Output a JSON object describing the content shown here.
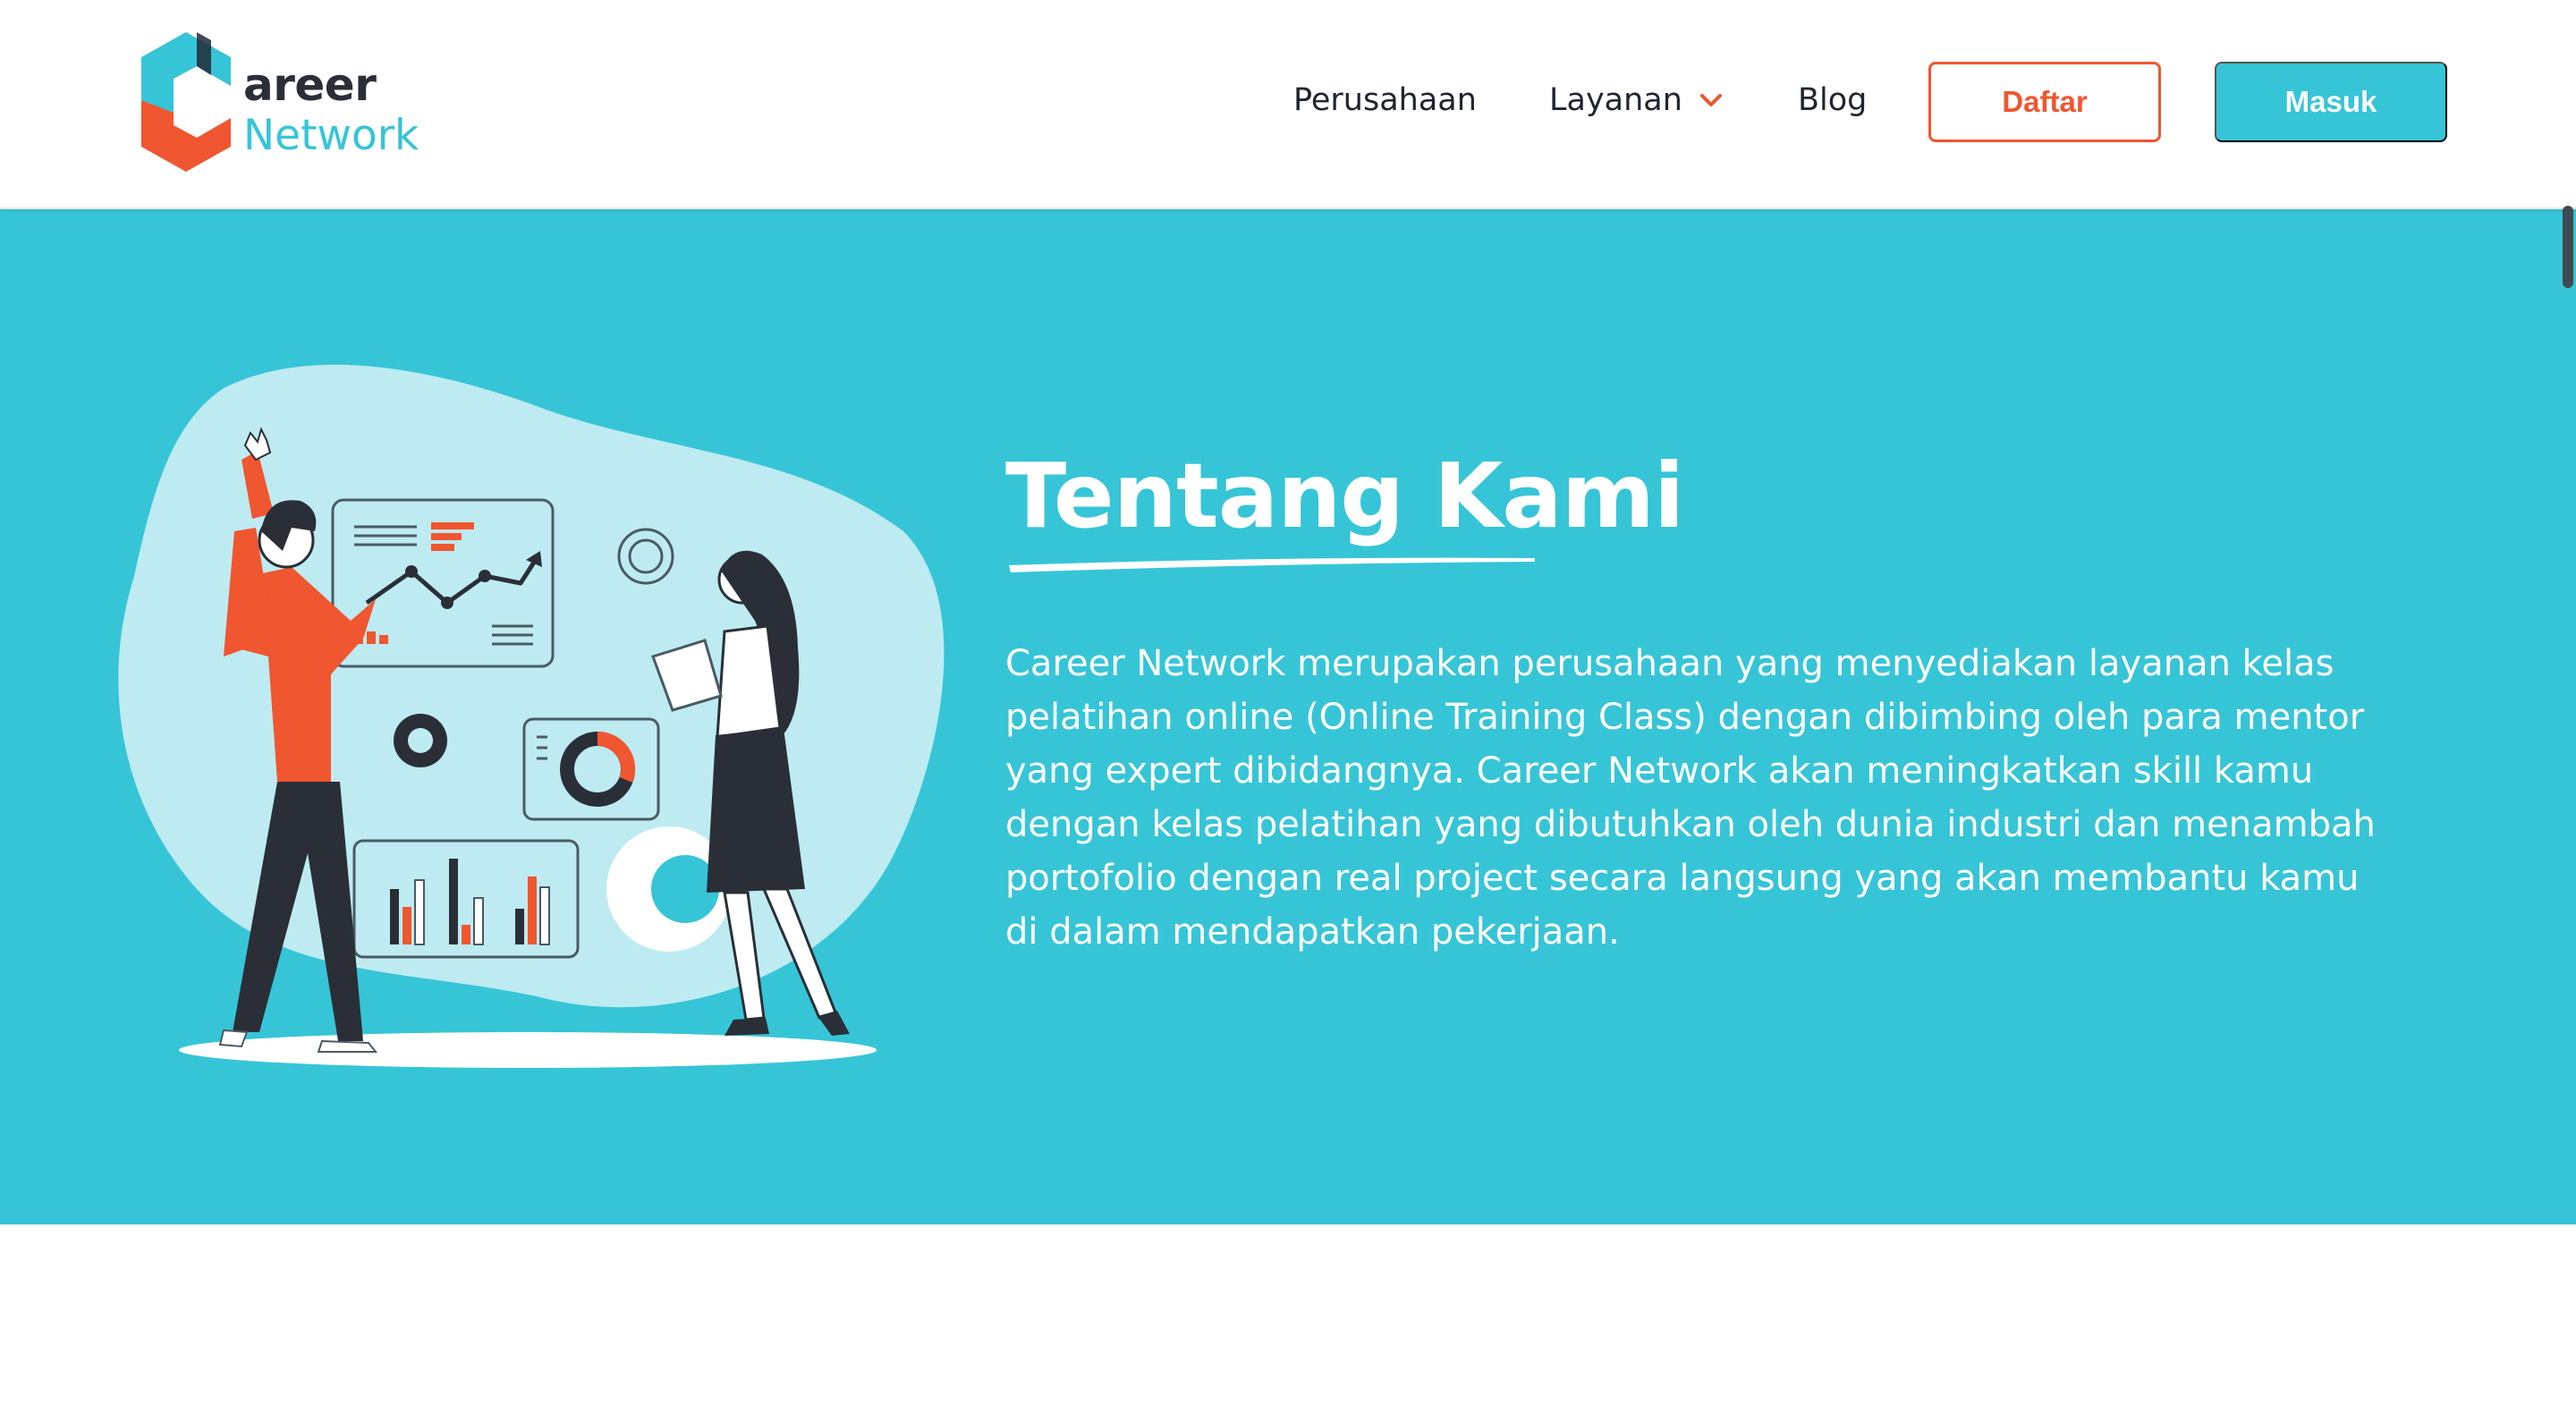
{
  "brand": {
    "logo_word_1": "areer",
    "logo_word_2": "Network",
    "colors": {
      "primary": "#35c5d7",
      "accent": "#f0562f",
      "dark": "#2a2f37"
    }
  },
  "nav": {
    "items": [
      {
        "label": "Perusahaan"
      },
      {
        "label": "Layanan",
        "icon": "chevron-down-icon"
      },
      {
        "label": "Blog"
      }
    ],
    "register_label": "Daftar",
    "login_label": "Masuk"
  },
  "hero": {
    "title": "Tentang Kami",
    "description": "Career Network merupakan perusahaan yang menyediakan layanan kelas pelatihan online (Online Training Class) dengan dibimbing oleh para mentor yang expert dibidangnya. Career Network akan meningkatkan skill kamu dengan kelas pelatihan yang dibutuhkan oleh dunia industri dan menambah portofolio dengan real project secara langsung yang akan membantu kamu di dalam mendapatkan pekerjaan."
  }
}
